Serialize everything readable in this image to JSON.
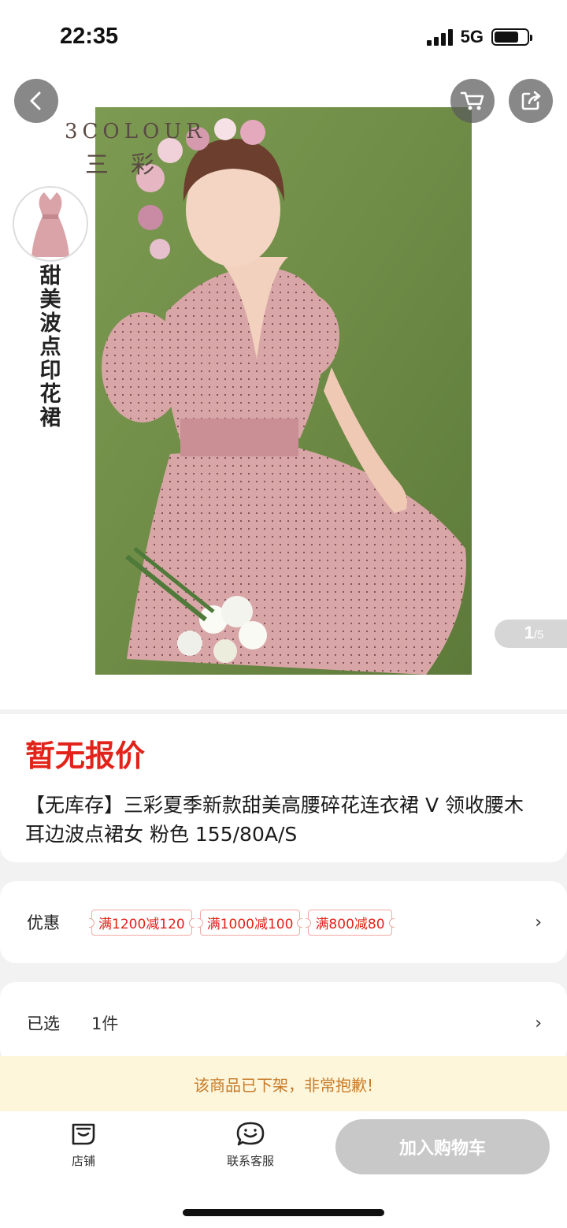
{
  "status_bar": {
    "time": "22:35",
    "network": "5G",
    "signal_bars": 4,
    "battery_level": 0.75
  },
  "gallery": {
    "brand_en": "3COLOUR",
    "brand_cn": "三彩",
    "thumb_label_chars": [
      "甜",
      "美",
      "波",
      "点",
      "印",
      "花",
      "裙"
    ],
    "page_current": "1",
    "page_total": "/5",
    "icons": [
      "back-icon",
      "cart-icon",
      "share-icon"
    ]
  },
  "product": {
    "price_text": "暂无报价",
    "title": "【无库存】三彩夏季新款甜美高腰碎花连衣裙 V 领收腰木耳边波点裙女 粉色 155/80A/S"
  },
  "promo": {
    "label": "优惠",
    "coupons": [
      "满1200减120",
      "满1000减100",
      "满800减80"
    ]
  },
  "selected": {
    "label": "已选",
    "value": "1件"
  },
  "notice": "该商品已下架，非常抱歉!",
  "bottom_bar": {
    "shop_label": "店铺",
    "service_label": "联系客服",
    "add_to_cart": "加入购物车"
  },
  "colors": {
    "price_red": "#e2231a",
    "notice_bg": "#fdf6da",
    "notice_text": "#c77b2a",
    "disabled_button": "#c8c8c8"
  }
}
